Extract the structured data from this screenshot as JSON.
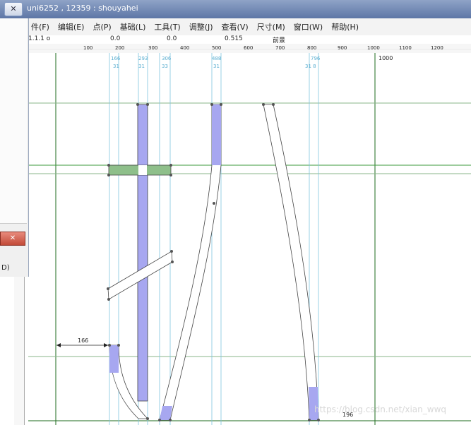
{
  "window": {
    "title": "uni6252 , 12359 : shouyahei",
    "close_glyph": "✕"
  },
  "menubar": {
    "items": [
      "件(F)",
      "编辑(E)",
      "点(P)",
      "基础(L)",
      "工具(T)",
      "调整(J)",
      "查看(V)",
      "尺寸(M)",
      "窗口(W)",
      "帮助(H)"
    ]
  },
  "infobar": {
    "values": [
      "0",
      "0.0",
      "0.0",
      "0",
      "1.1.1 o",
      "0.515",
      "前景"
    ]
  },
  "ruler": {
    "ticks": [
      "100",
      "200",
      "300",
      "400",
      "500",
      "600",
      "700",
      "800",
      "900",
      "1000",
      "1100",
      "1200"
    ],
    "end_label": "1000"
  },
  "guides": {
    "labels_top": [
      "166",
      "293",
      "306",
      "488",
      "796"
    ],
    "labels_bottom": [
      "31",
      "31",
      "33",
      "31",
      "31 8"
    ]
  },
  "dimension": {
    "width_label": "166",
    "bottom_label": "196"
  },
  "dialog": {
    "close_glyph": "✕",
    "text": "D)"
  },
  "glyph": {
    "name": "uni6252",
    "unicode": "扒"
  },
  "watermark": "https://blog.csdn.net/xian_wwq",
  "colors": {
    "fill": "#a7a7f0",
    "cross": "#8ebf8a",
    "guide_green": "#2e8b2e",
    "guide_cyan": "#66b8d8"
  }
}
